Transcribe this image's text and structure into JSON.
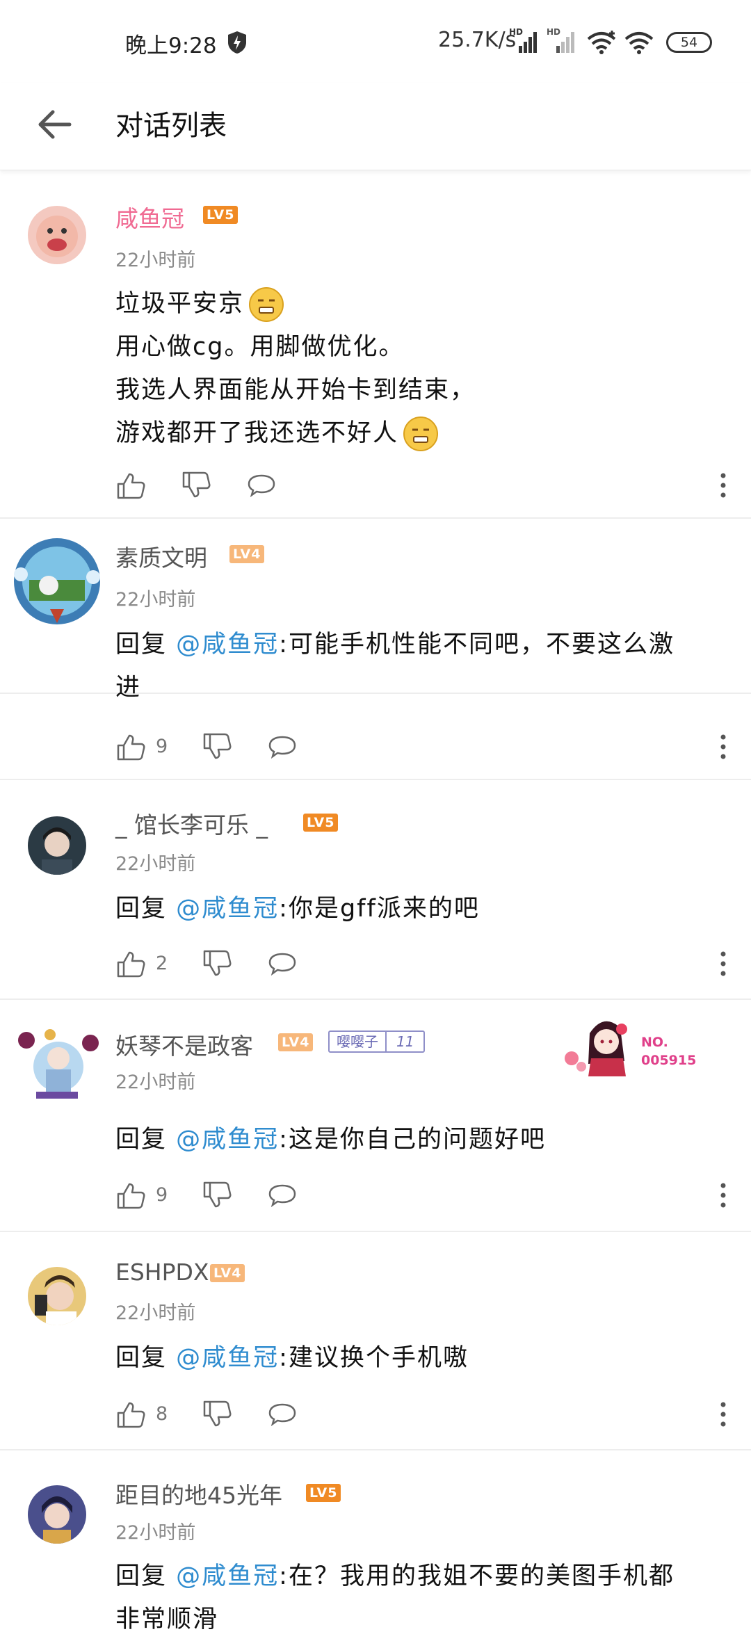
{
  "status_bar": {
    "time": "晚上9:28",
    "speed": "25.7K/s",
    "sim1": "HD",
    "sim2": "HD",
    "battery": "54"
  },
  "header": {
    "title": "对话列表"
  },
  "colors": {
    "mention": "#2f8ccf",
    "lv5": "#f08a24",
    "lv4": "#f7b77a",
    "pink_name": "#f06a92"
  },
  "comments": [
    {
      "username": "咸鱼冠",
      "level": "LV5",
      "time": "22小时前",
      "lines": [
        "垃圾平安京",
        "用心做cg。用脚做优化。",
        "我选人界面能从开始卡到结束，",
        "游戏都开了我还选不好人"
      ],
      "likes": ""
    },
    {
      "username": "素质文明",
      "level": "LV4",
      "time": "22小时前",
      "reply_prefix": "回复",
      "mention": "@咸鱼冠",
      "text": ":可能手机性能不同吧，不要这么激",
      "text2": "进",
      "likes": "9"
    },
    {
      "username": "_ 馆长李可乐 _",
      "level": "LV5",
      "time": "22小时前",
      "reply_prefix": "回复",
      "mention": "@咸鱼冠",
      "text": ":你是gff派来的吧",
      "likes": "2"
    },
    {
      "username": "妖琴不是政客",
      "level": "LV4",
      "time": "22小时前",
      "fan_badge": "嘤嘤子",
      "fan_level": "11",
      "card_no": "NO.",
      "card_num": "005915",
      "reply_prefix": "回复",
      "mention": "@咸鱼冠",
      "text": ":这是你自己的问题好吧",
      "likes": "9"
    },
    {
      "username": "ESHPDX",
      "level": "LV4",
      "time": "22小时前",
      "reply_prefix": "回复",
      "mention": "@咸鱼冠",
      "text": ":建议换个手机嗷",
      "likes": "8"
    },
    {
      "username": "距目的地45光年",
      "level": "LV5",
      "time": "22小时前",
      "reply_prefix": "回复",
      "mention": "@咸鱼冠",
      "text": ":在？我用的我姐不要的美图手机都",
      "text2": "非常顺滑",
      "likes": ""
    }
  ]
}
